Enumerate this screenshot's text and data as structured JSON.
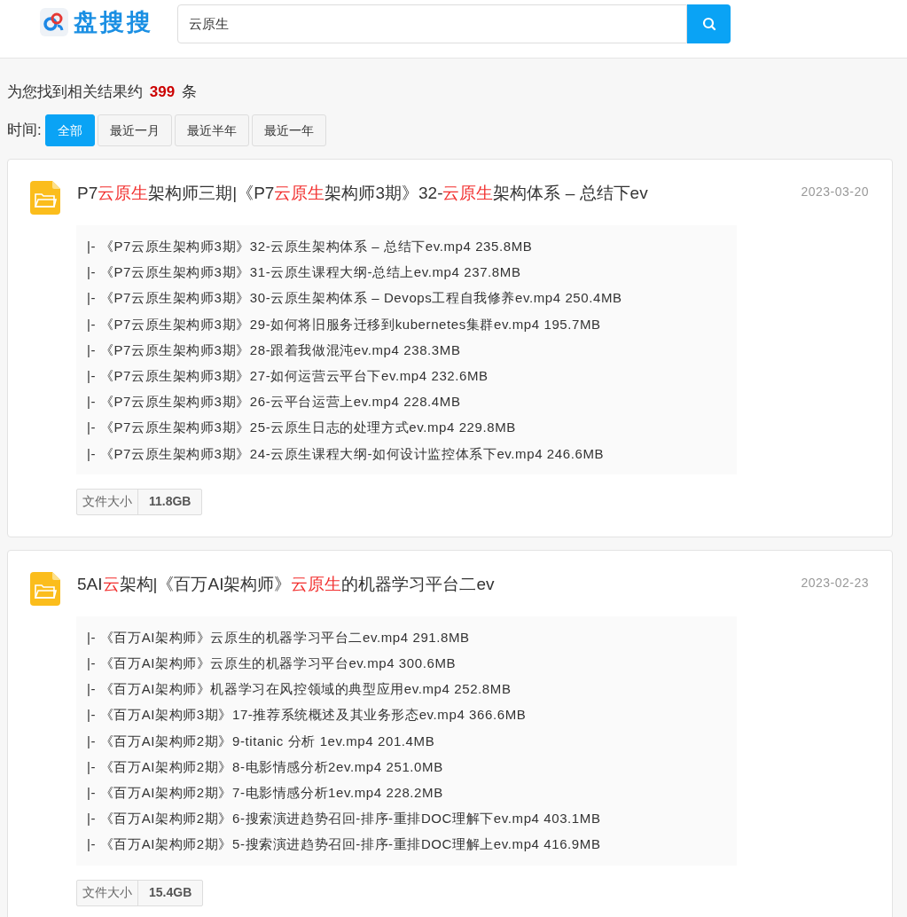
{
  "header": {
    "logo_text": "盘搜搜",
    "search": {
      "value": "云原生"
    }
  },
  "summary": {
    "prefix": "为您找到相关结果约",
    "count": "399",
    "suffix": "条"
  },
  "time_filter": {
    "label": "时间:",
    "options": [
      {
        "label": "全部",
        "selected": true
      },
      {
        "label": "最近一月",
        "selected": false
      },
      {
        "label": "最近半年",
        "selected": false
      },
      {
        "label": "最近一年",
        "selected": false
      }
    ]
  },
  "results": [
    {
      "title": [
        {
          "text": "P7",
          "highlight": false
        },
        {
          "text": "云原生",
          "highlight": true
        },
        {
          "text": "架构师三期|《P7",
          "highlight": false
        },
        {
          "text": "云原生",
          "highlight": true
        },
        {
          "text": "架构师3期》32-",
          "highlight": false
        },
        {
          "text": "云原生",
          "highlight": true
        },
        {
          "text": "架构体系 – 总结下ev",
          "highlight": false
        }
      ],
      "date": "2023-03-20",
      "files": [
        "|- 《P7云原生架构师3期》32-云原生架构体系 – 总结下ev.mp4 235.8MB",
        "|- 《P7云原生架构师3期》31-云原生课程大纲-总结上ev.mp4 237.8MB",
        "|- 《P7云原生架构师3期》30-云原生架构体系 – Devops工程自我修养ev.mp4 250.4MB",
        "|- 《P7云原生架构师3期》29-如何将旧服务迁移到kubernetes集群ev.mp4 195.7MB",
        "|- 《P7云原生架构师3期》28-跟着我做混沌ev.mp4 238.3MB",
        "|- 《P7云原生架构师3期》27-如何运营云平台下ev.mp4 232.6MB",
        "|- 《P7云原生架构师3期》26-云平台运营上ev.mp4 228.4MB",
        "|- 《P7云原生架构师3期》25-云原生日志的处理方式ev.mp4 229.8MB",
        "|- 《P7云原生架构师3期》24-云原生课程大纲-如何设计监控体系下ev.mp4 246.6MB"
      ],
      "size_label": "文件大小",
      "size": "11.8GB"
    },
    {
      "title": [
        {
          "text": "5AI",
          "highlight": false
        },
        {
          "text": "云",
          "highlight": true
        },
        {
          "text": "架构|《百万AI架构师》",
          "highlight": false
        },
        {
          "text": "云原生",
          "highlight": true
        },
        {
          "text": "的机器学习平台二ev",
          "highlight": false
        }
      ],
      "date": "2023-02-23",
      "files": [
        "|- 《百万AI架构师》云原生的机器学习平台二ev.mp4 291.8MB",
        "|- 《百万AI架构师》云原生的机器学习平台ev.mp4 300.6MB",
        "|- 《百万AI架构师》机器学习在风控领域的典型应用ev.mp4 252.8MB",
        "|- 《百万AI架构师3期》17-推荐系统概述及其业务形态ev.mp4 366.6MB",
        "|- 《百万AI架构师2期》9-titanic 分析 1ev.mp4 201.4MB",
        "|- 《百万AI架构师2期》8-电影情感分析2ev.mp4 251.0MB",
        "|- 《百万AI架构师2期》7-电影情感分析1ev.mp4 228.2MB",
        "|- 《百万AI架构师2期》6-搜索演进趋势召回-排序-重排DOC理解下ev.mp4 403.1MB",
        "|- 《百万AI架构师2期》5-搜索演进趋势召回-排序-重排DOC理解上ev.mp4 416.9MB"
      ],
      "size_label": "文件大小",
      "size": "15.4GB"
    }
  ]
}
